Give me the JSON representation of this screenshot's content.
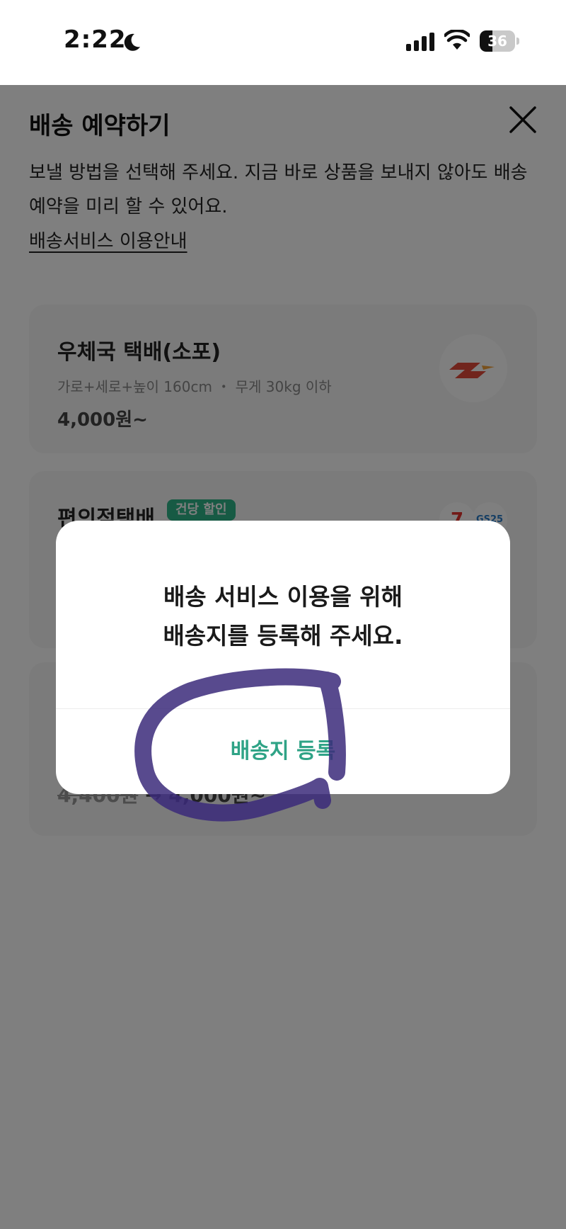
{
  "status_bar": {
    "time": "2:22",
    "battery_level": "36",
    "battery_fraction": 0.36,
    "icons": [
      "moon-icon",
      "signal-icon",
      "wifi-icon",
      "battery-icon"
    ]
  },
  "sheet": {
    "title": "배송 예약하기",
    "description": "보낼 방법을 선택해 주세요. 지금 바로 상품을 보내지 않아도 배송 예약을 미리 할 수 있어요.",
    "guide_link": "배송서비스 이용안내",
    "cards": [
      {
        "name": "우체국 택배(소포)",
        "spec": "가로+세로+높이 160cm ・ 무게 30kg 이하",
        "price": "4,000원~"
      },
      {
        "name": "편의점택배",
        "badge": "건당 할인",
        "logo_a": "7",
        "logo_b": "GS25"
      },
      {
        "price_original": "4,400원",
        "price_sale": "4,000원~"
      }
    ]
  },
  "dialog": {
    "message_line1": "배송 서비스 이용을 위해",
    "message_line2": "배송지를 등록해 주세요.",
    "button_label": "배송지 등록"
  },
  "colors": {
    "accent": "#2fa386",
    "badge": "#2fb488",
    "overlay": "rgba(0,0,0,0.5)",
    "scribble": "#3b2a7a"
  }
}
